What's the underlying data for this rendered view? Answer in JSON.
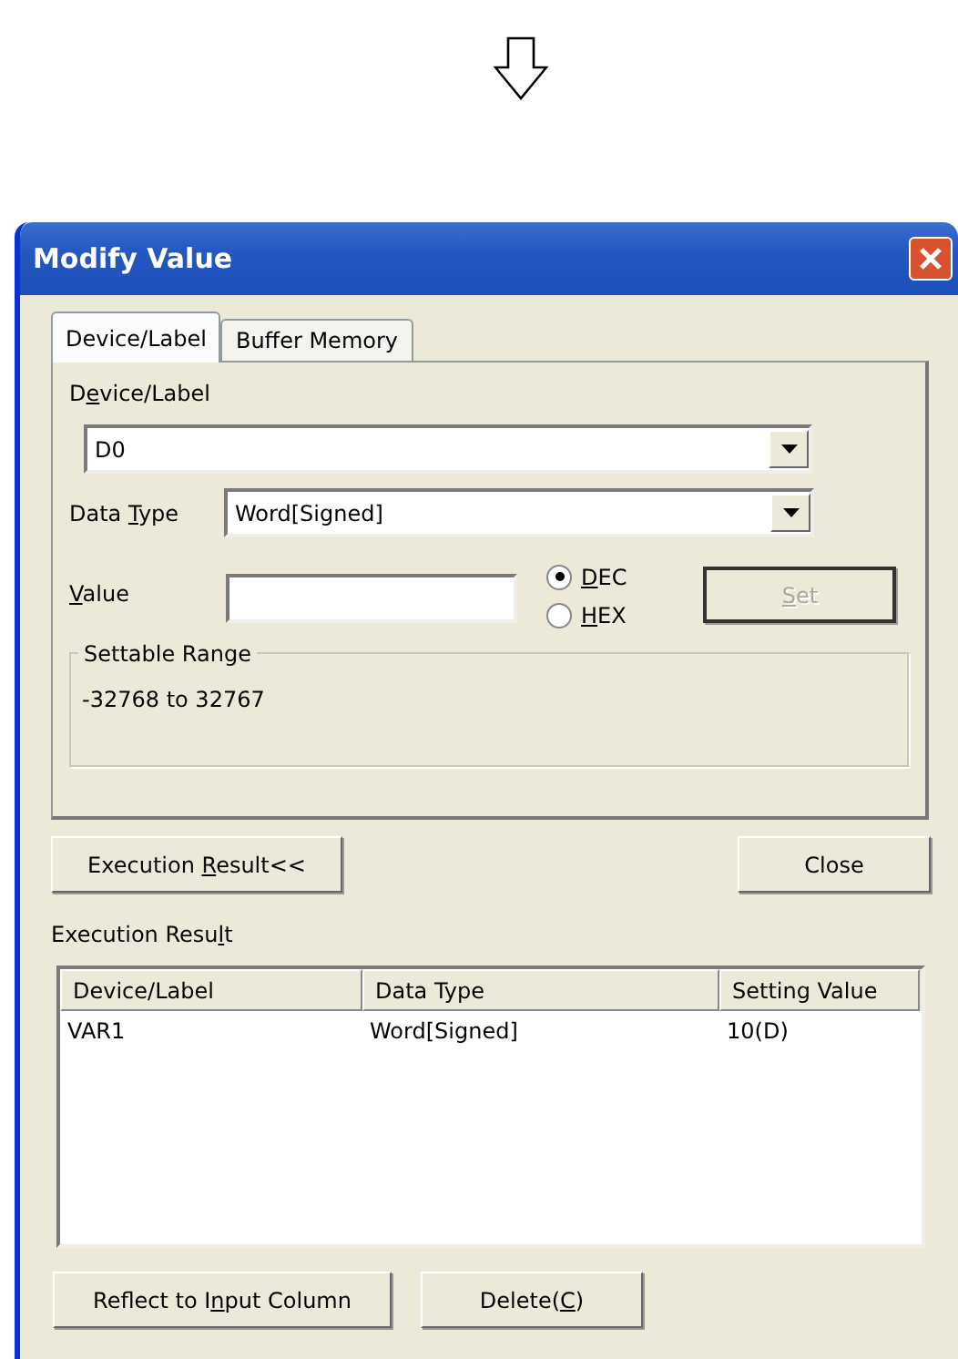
{
  "window": {
    "title": "Modify Value"
  },
  "tabs": [
    {
      "label": "Device/Label",
      "selected": true
    },
    {
      "label": "Buffer Memory",
      "selected": false
    }
  ],
  "device_label": {
    "label": {
      "pre": "D",
      "key": "e",
      "post": "vice/Label"
    },
    "value": "D0"
  },
  "data_type": {
    "label": {
      "pre": "Data ",
      "key": "T",
      "post": "ype"
    },
    "value": "Word[Signed]"
  },
  "value": {
    "label": {
      "key": "V",
      "post": "alue"
    }
  },
  "radix": [
    {
      "label": {
        "key": "D",
        "post": "EC"
      },
      "selected": true
    },
    {
      "label": {
        "key": "H",
        "post": "EX"
      },
      "selected": false
    }
  ],
  "set_button": {
    "label": {
      "key": "S",
      "post": "et"
    },
    "disabled": true
  },
  "settable_range": {
    "title": "Settable Range",
    "text": "-32768 to 32767"
  },
  "execution_result_button": {
    "label": {
      "pre": "Execution ",
      "key": "R",
      "post": "esult<<"
    }
  },
  "close_button": {
    "label": {
      "pre": "Close"
    }
  },
  "execution_result": {
    "label": {
      "pre": "Execution Resu",
      "key": "l",
      "post": "t"
    },
    "columns": [
      "Device/Label",
      "Data Type",
      "Setting Value"
    ],
    "rows": [
      [
        "VAR1",
        "Word[Signed]",
        "10(D)"
      ]
    ]
  },
  "bottom_buttons": [
    {
      "label": {
        "pre": "Reflect to I",
        "key": "n",
        "post": "put Column"
      }
    },
    {
      "label": {
        "pre": "Delete(",
        "key": "C",
        "post": ")"
      }
    }
  ]
}
